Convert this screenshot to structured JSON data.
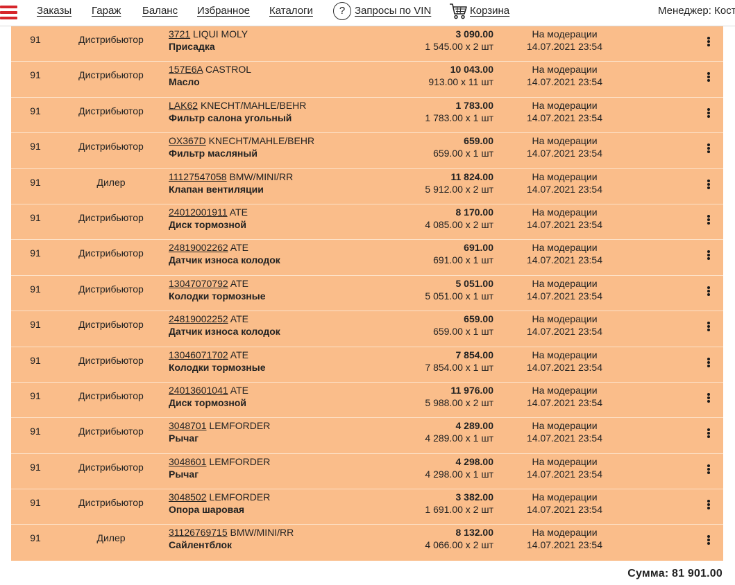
{
  "nav": {
    "orders": "Заказы",
    "garage": "Гараж",
    "balance": "Баланс",
    "favorites": "Избранное",
    "catalogs": "Каталоги",
    "vin_icon": "?",
    "vin_requests": "Запросы по VIN",
    "cart": "Корзина",
    "manager": "Менеджер: Кост"
  },
  "icons": {
    "menu": "hamburger-icon",
    "vin": "question-circle-icon",
    "cart": "cart-icon",
    "row_menu": "kebab-menu-icon"
  },
  "colors": {
    "row_bg": "#fabd8a",
    "accent": "#d6262c"
  },
  "rows": [
    {
      "num": "91",
      "type": "Дистрибьютор",
      "code": "3721",
      "brand": "LIQUI MOLY",
      "name": "Присадка",
      "total": "3 090.00",
      "unit": "1 545.00 x 2 шт",
      "status": "На модерации",
      "date": "14.07.2021 23:54"
    },
    {
      "num": "91",
      "type": "Дистрибьютор",
      "code": "157E6A",
      "brand": "CASTROL",
      "name": "Масло",
      "total": "10 043.00",
      "unit": "913.00 x 11 шт",
      "status": "На модерации",
      "date": "14.07.2021 23:54"
    },
    {
      "num": "91",
      "type": "Дистрибьютор",
      "code": "LAK62",
      "brand": "KNECHT/MAHLE/BEHR",
      "name": "Фильтр салона угольный",
      "total": "1 783.00",
      "unit": "1 783.00 x 1 шт",
      "status": "На модерации",
      "date": "14.07.2021 23:54"
    },
    {
      "num": "91",
      "type": "Дистрибьютор",
      "code": "OX367D",
      "brand": "KNECHT/MAHLE/BEHR",
      "name": "Фильтр масляный",
      "total": "659.00",
      "unit": "659.00 x 1 шт",
      "status": "На модерации",
      "date": "14.07.2021 23:54"
    },
    {
      "num": "91",
      "type": "Дилер",
      "code": "11127547058",
      "brand": "BMW/MINI/RR",
      "name": "Клапан вентиляции",
      "total": "11 824.00",
      "unit": "5 912.00 x 2 шт",
      "status": "На модерации",
      "date": "14.07.2021 23:54"
    },
    {
      "num": "91",
      "type": "Дистрибьютор",
      "code": "24012001911",
      "brand": "ATE",
      "name": "Диск тормозной",
      "total": "8 170.00",
      "unit": "4 085.00 x 2 шт",
      "status": "На модерации",
      "date": "14.07.2021 23:54"
    },
    {
      "num": "91",
      "type": "Дистрибьютор",
      "code": "24819002262",
      "brand": "ATE",
      "name": "Датчик износа колодок",
      "total": "691.00",
      "unit": "691.00 x 1 шт",
      "status": "На модерации",
      "date": "14.07.2021 23:54"
    },
    {
      "num": "91",
      "type": "Дистрибьютор",
      "code": "13047070792",
      "brand": "ATE",
      "name": "Колодки тормозные",
      "total": "5 051.00",
      "unit": "5 051.00 x 1 шт",
      "status": "На модерации",
      "date": "14.07.2021 23:54"
    },
    {
      "num": "91",
      "type": "Дистрибьютор",
      "code": "24819002252",
      "brand": "ATE",
      "name": "Датчик износа колодок",
      "total": "659.00",
      "unit": "659.00 x 1 шт",
      "status": "На модерации",
      "date": "14.07.2021 23:54"
    },
    {
      "num": "91",
      "type": "Дистрибьютор",
      "code": "13046071702",
      "brand": "ATE",
      "name": "Колодки тормозные",
      "total": "7 854.00",
      "unit": "7 854.00 x 1 шт",
      "status": "На модерации",
      "date": "14.07.2021 23:54"
    },
    {
      "num": "91",
      "type": "Дистрибьютор",
      "code": "24013601041",
      "brand": "ATE",
      "name": "Диск тормозной",
      "total": "11 976.00",
      "unit": "5 988.00 x 2 шт",
      "status": "На модерации",
      "date": "14.07.2021 23:54"
    },
    {
      "num": "91",
      "type": "Дистрибьютор",
      "code": "3048701",
      "brand": "LEMFORDER",
      "name": "Рычаг",
      "total": "4 289.00",
      "unit": "4 289.00 x 1 шт",
      "status": "На модерации",
      "date": "14.07.2021 23:54"
    },
    {
      "num": "91",
      "type": "Дистрибьютор",
      "code": "3048601",
      "brand": "LEMFORDER",
      "name": "Рычаг",
      "total": "4 298.00",
      "unit": "4 298.00 x 1 шт",
      "status": "На модерации",
      "date": "14.07.2021 23:54"
    },
    {
      "num": "91",
      "type": "Дистрибьютор",
      "code": "3048502",
      "brand": "LEMFORDER",
      "name": "Опора шаровая",
      "total": "3 382.00",
      "unit": "1 691.00 x 2 шт",
      "status": "На модерации",
      "date": "14.07.2021 23:54"
    },
    {
      "num": "91",
      "type": "Дилер",
      "code": "31126769715",
      "brand": "BMW/MINI/RR",
      "name": "Сайлентблок",
      "total": "8 132.00",
      "unit": "4 066.00 x 2 шт",
      "status": "На модерации",
      "date": "14.07.2021 23:54"
    }
  ],
  "summary": {
    "total_label": "Сумма: 81 901.00"
  }
}
